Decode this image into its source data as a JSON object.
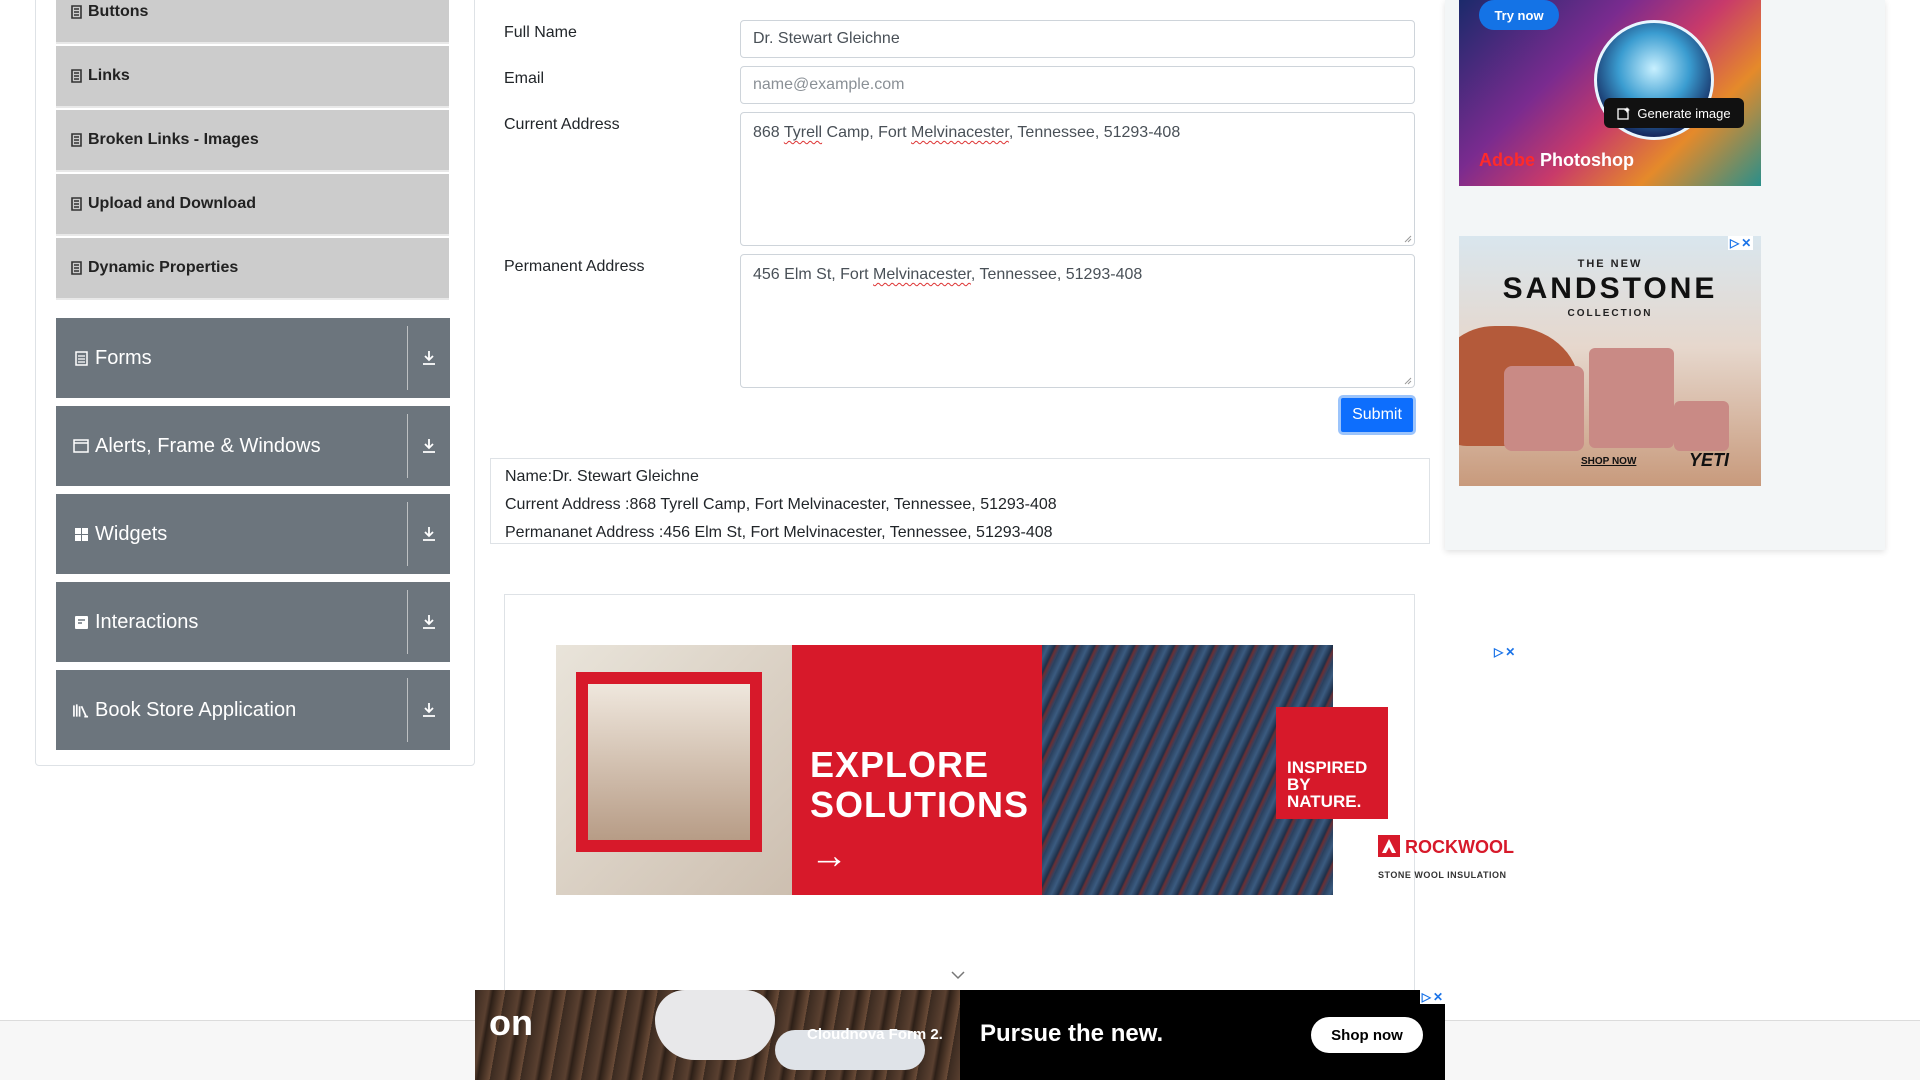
{
  "sidebar": {
    "sub_items": [
      {
        "label": "Buttons",
        "icon": "page-icon"
      },
      {
        "label": "Links",
        "icon": "page-icon"
      },
      {
        "label": "Broken Links - Images",
        "icon": "page-icon"
      },
      {
        "label": "Upload and Download",
        "icon": "page-icon"
      },
      {
        "label": "Dynamic Properties",
        "icon": "page-icon"
      }
    ],
    "groups": [
      {
        "label": "Forms",
        "icon": "form-icon"
      },
      {
        "label": "Alerts, Frame & Windows",
        "icon": "window-icon"
      },
      {
        "label": "Widgets",
        "icon": "widgets-icon"
      },
      {
        "label": "Interactions",
        "icon": "interaction-icon"
      },
      {
        "label": "Book Store Application",
        "icon": "books-icon"
      }
    ]
  },
  "form": {
    "full_name": {
      "label": "Full Name",
      "value": "Dr. Stewart Gleichne"
    },
    "email": {
      "label": "Email",
      "placeholder": "name@example.com",
      "value": ""
    },
    "current_address": {
      "label": "Current Address",
      "value_parts": [
        "868 ",
        "Tyrell",
        " Camp, Fort ",
        "Melvinacester",
        ", Tennessee, 51293-408"
      ]
    },
    "permanent_address": {
      "label": "Permanent Address",
      "value_parts": [
        "456 Elm St, Fort ",
        "Melvinacester",
        ", Tennessee, 51293-408"
      ]
    },
    "submit_label": "Submit"
  },
  "output": {
    "name": "Name:Dr. Stewart Gleichne",
    "current_address": "Current Address :868 Tyrell Camp, Fort Melvinacester, Tennessee, 51293-408",
    "permanent_address": "Permananet Address :456 Elm St, Fort Melvinacester, Tennessee, 51293-408"
  },
  "ads": {
    "photoshop": {
      "try_now": "Try now",
      "generate": "Generate image",
      "brand_adobe": "Adobe",
      "brand_product": "Photoshop"
    },
    "yeti": {
      "line1": "THE NEW",
      "line2": "SANDSTONE",
      "line3": "COLLECTION",
      "shop": "SHOP NOW",
      "logo": "YETI",
      "badge": "YETI"
    },
    "rockwool": {
      "headline_1": "EXPLORE",
      "headline_2": "SOLUTIONS",
      "arrow": "→",
      "inspired_1": "INSPIRED",
      "inspired_2": "BY",
      "inspired_3": "NATURE.",
      "brand": "ROCKWOOL",
      "tagline": "STONE WOOL INSULATION"
    },
    "on": {
      "logo": "on",
      "model": "Cloudnova Form 2.",
      "headline": "Pursue the new.",
      "cta": "Shop now"
    },
    "choice_glyphs": {
      "play": "▷",
      "close": "✕"
    }
  },
  "colors": {
    "primary": "#0d6efd",
    "sidebar_group": "#6c757d",
    "sidebar_sub": "#cccccc",
    "rockwool_red": "#d7192a"
  }
}
